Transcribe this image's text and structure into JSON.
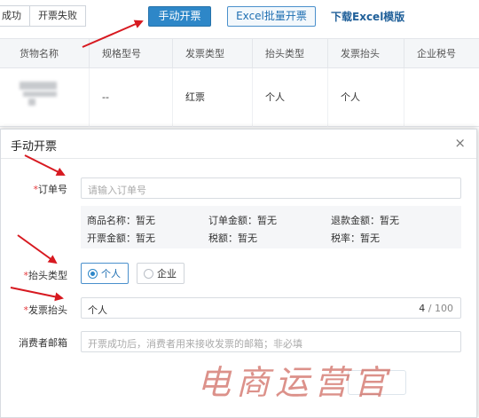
{
  "toolbar": {
    "status_tabs": [
      "成功",
      "开票失败"
    ],
    "manual_invoice_label": "手动开票",
    "excel_batch_label": "Excel批量开票",
    "download_label": "下载Excel模版"
  },
  "table": {
    "headers": [
      "货物名称",
      "规格型号",
      "发票类型",
      "抬头类型",
      "发票抬头",
      "企业税号"
    ],
    "rows": [
      {
        "spec": "--",
        "invoice_type": "红票",
        "title_type": "个人",
        "title": "个人"
      }
    ]
  },
  "dialog": {
    "title": "手动开票",
    "close_glyph": "×",
    "order_no": {
      "label": "订单号",
      "placeholder": "请输入订单号"
    },
    "info": {
      "product_name": "商品名称：暂无",
      "order_amount": "订单金额：暂无",
      "refund_amount": "退款金额：暂无",
      "invoice_amount": "开票金额：暂无",
      "tax": "税额：暂无",
      "tax_rate": "税率：暂无"
    },
    "title_type": {
      "label": "抬头类型",
      "options": [
        "个人",
        "企业"
      ],
      "selected": "个人"
    },
    "invoice_title": {
      "label": "发票抬头",
      "value": "个人",
      "count": "4",
      "max": " / 100"
    },
    "consumer_email": {
      "label": "消费者邮箱",
      "placeholder": "开票成功后，消费者用来接收发票的邮箱；非必填"
    },
    "required_mark": "*"
  },
  "watermark": "电商运营官",
  "colors": {
    "primary": "#2e87c8",
    "required": "#e4393c",
    "arrow": "#d71920"
  }
}
